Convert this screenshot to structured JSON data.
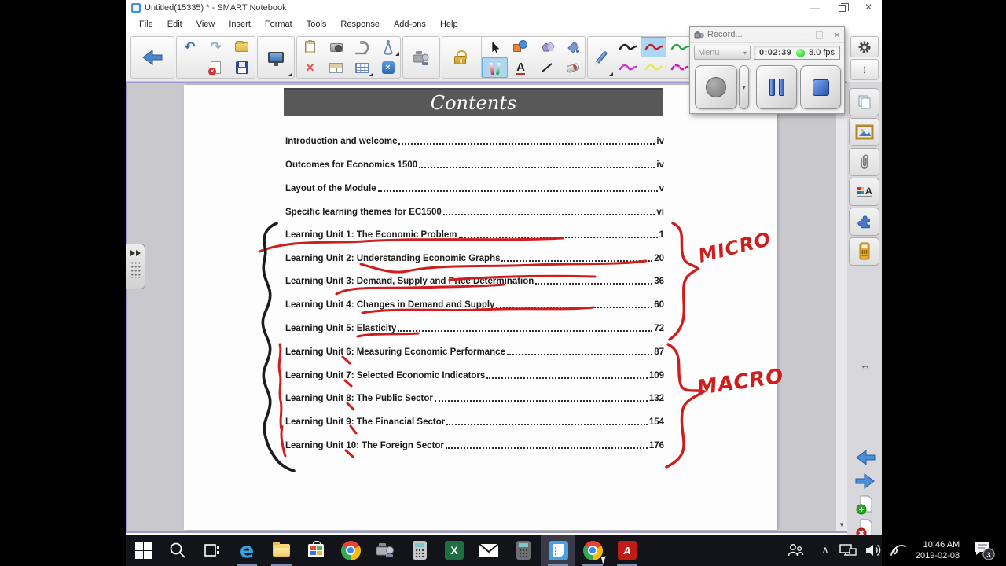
{
  "window": {
    "title": "Untitled(15335) * - SMART Notebook"
  },
  "menu_bar": {
    "items": [
      "File",
      "Edit",
      "View",
      "Insert",
      "Format",
      "Tools",
      "Response",
      "Add-ons",
      "Help"
    ]
  },
  "glyphs": {
    "minimize": "—",
    "close": "×",
    "dropdown": "▾",
    "undo": "↶",
    "redo": "↷",
    "delete_x": "×",
    "toolbox_x": "×",
    "chevron_up": "∧",
    "updown": "↕",
    "leftright": "↔",
    "scroll_up": "▴",
    "scroll_down": "▾"
  },
  "toolbar": {
    "tools": [
      "back",
      "undo",
      "redo",
      "open-file",
      "delete-page",
      "save",
      "screen-capture",
      "paste-capture",
      "camera",
      "document-camera",
      "measurement-tools",
      "delete",
      "screen-shade",
      "table",
      "toolbox",
      "lecture-recorder",
      "lock",
      "add-ons",
      "select",
      "shapes",
      "polygons",
      "fill",
      "pens",
      "text",
      "line",
      "eraser",
      "pen",
      "color-black",
      "color-red",
      "color-green",
      "color-magenta",
      "color-yellow",
      "color-magenta-dash"
    ]
  },
  "recorder": {
    "title": "Record...",
    "menu_label": "Menu",
    "elapsed": "0:02:39",
    "fps": "8.0 fps"
  },
  "sidebar": {
    "tabs": [
      "page-sorter",
      "gallery",
      "attachments",
      "properties",
      "add-ons",
      "response"
    ]
  },
  "page": {
    "header": "Contents",
    "toc": [
      {
        "label": "Introduction and welcome",
        "page": "iv"
      },
      {
        "label": "Outcomes for Economics 1500",
        "page": "iv"
      },
      {
        "label": "Layout of the Module",
        "page": "v"
      },
      {
        "label": "Specific learning themes for EC1500",
        "page": "vi"
      },
      {
        "label": "Learning Unit 1: The Economic Problem",
        "page": "1"
      },
      {
        "label": "Learning Unit 2: Understanding Economic Graphs",
        "page": "20"
      },
      {
        "label": "Learning Unit 3: Demand, Supply and Price Determination",
        "page": "36"
      },
      {
        "label": "Learning Unit 4: Changes in Demand and Supply",
        "page": "60"
      },
      {
        "label": "Learning Unit 5: Elasticity",
        "page": "72"
      },
      {
        "label": "Learning Unit 6: Measuring Economic Performance",
        "page": "87"
      },
      {
        "label": "Learning Unit 7: Selected Economic Indicators",
        "page": "109"
      },
      {
        "label": "Learning Unit 8: The Public Sector",
        "page": "132"
      },
      {
        "label": "Learning Unit 9: The Financial Sector",
        "page": "154"
      },
      {
        "label": "Learning Unit 10: The Foreign Sector",
        "page": "176"
      }
    ]
  },
  "annotations": {
    "micro": "MICRO",
    "macro": "MACRO"
  },
  "taskbar": {
    "icons": [
      "start",
      "search",
      "task-view",
      "edge",
      "file-explorer",
      "store",
      "chrome",
      "recorder",
      "calculator",
      "excel",
      "mail",
      "calculator-2",
      "smart-notebook",
      "chrome-active",
      "acrobat",
      "people",
      "tray-chevron",
      "network",
      "volume",
      "ink",
      "clock",
      "notifications"
    ],
    "clock_time": "10:46 AM",
    "clock_date": "2019-02-08",
    "notification_count": "3"
  },
  "colors": {
    "ink_red": "#cf1d1d",
    "ink_black": "#1c1c1c",
    "banner_gray": "#585858",
    "record_green": "#12c812",
    "accent_blue": "#4a86c8"
  }
}
